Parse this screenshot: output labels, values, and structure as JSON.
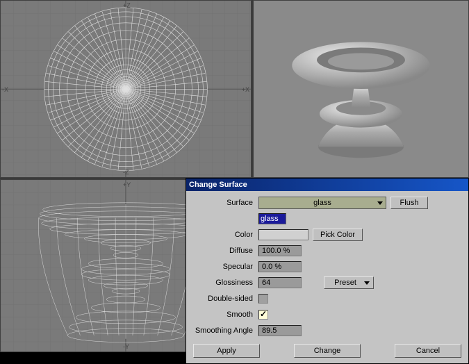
{
  "viewports": {
    "top": {
      "axes": {
        "up": "+Z",
        "down": "-Z",
        "left": "-X",
        "right": "+X"
      }
    },
    "front": {
      "axes": {
        "up": "+Y",
        "down": "-Y"
      }
    }
  },
  "dialog": {
    "title": "Change Surface",
    "labels": {
      "surface": "Surface",
      "color": "Color",
      "diffuse": "Diffuse",
      "specular": "Specular",
      "glossiness": "Glossiness",
      "doublesided": "Double-sided",
      "smooth": "Smooth",
      "smoothingangle": "Smoothing Angle"
    },
    "values": {
      "surface_dropdown": "glass",
      "surface_text": "glass",
      "color_hex": "#d0d0d0",
      "diffuse": "100.0 %",
      "specular": "0.0 %",
      "glossiness": "64",
      "smooth_checked": true,
      "doublesided_checked": false,
      "smoothing_angle": "89.5"
    },
    "buttons": {
      "flush": "Flush",
      "pickcolor": "Pick Color",
      "preset": "Preset",
      "apply": "Apply",
      "change": "Change",
      "cancel": "Cancel"
    }
  }
}
